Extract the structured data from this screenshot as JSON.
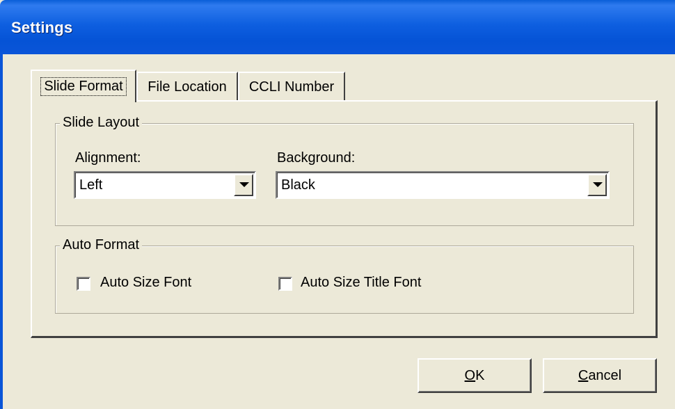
{
  "window": {
    "title": "Settings"
  },
  "tabs": [
    {
      "label": "Slide Format",
      "active": true
    },
    {
      "label": "File Location",
      "active": false
    },
    {
      "label": "CCLI Number",
      "active": false
    }
  ],
  "slide_layout": {
    "group_label": "Slide Layout",
    "alignment": {
      "label": "Alignment:",
      "value": "Left"
    },
    "background": {
      "label": "Background:",
      "value": "Black"
    }
  },
  "auto_format": {
    "group_label": "Auto Format",
    "auto_size_font": {
      "label": "Auto Size Font",
      "checked": false
    },
    "auto_size_title_font": {
      "label": "Auto Size Title Font",
      "checked": false
    }
  },
  "buttons": {
    "ok_mnemonic": "O",
    "ok_rest": "K",
    "cancel_mnemonic": "C",
    "cancel_rest": "ancel"
  },
  "colors": {
    "titlebar": "#0A5FD8",
    "dialog_face": "#ECE9D8"
  }
}
